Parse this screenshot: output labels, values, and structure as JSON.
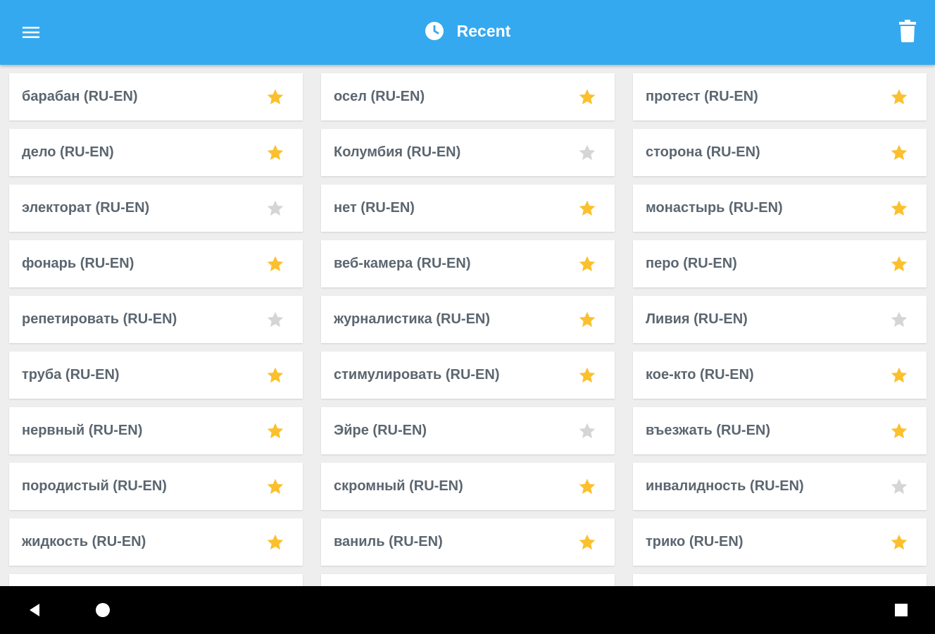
{
  "appbar": {
    "title": "Recent",
    "menu_icon": "hamburger-icon",
    "title_icon": "clock-icon",
    "trash_icon": "trash-icon",
    "background_color": "#35a9ef"
  },
  "colors": {
    "star_on": "#fbc02d",
    "star_off": "#d5d5d5",
    "label": "#5b6670"
  },
  "items": [
    {
      "label": "барабан (RU-EN)",
      "starred": true
    },
    {
      "label": "осел (RU-EN)",
      "starred": true
    },
    {
      "label": "протест (RU-EN)",
      "starred": true
    },
    {
      "label": "дело (RU-EN)",
      "starred": true
    },
    {
      "label": "Колумбия (RU-EN)",
      "starred": false
    },
    {
      "label": "сторона (RU-EN)",
      "starred": true
    },
    {
      "label": "электорат (RU-EN)",
      "starred": false
    },
    {
      "label": "нет (RU-EN)",
      "starred": true
    },
    {
      "label": "монастырь (RU-EN)",
      "starred": true
    },
    {
      "label": "фонарь (RU-EN)",
      "starred": true
    },
    {
      "label": "веб-камера (RU-EN)",
      "starred": true
    },
    {
      "label": "перо (RU-EN)",
      "starred": true
    },
    {
      "label": "репетировать (RU-EN)",
      "starred": false
    },
    {
      "label": "журналистика (RU-EN)",
      "starred": true
    },
    {
      "label": "Ливия (RU-EN)",
      "starred": false
    },
    {
      "label": "труба (RU-EN)",
      "starred": true
    },
    {
      "label": "стимулировать (RU-EN)",
      "starred": true
    },
    {
      "label": "кое-кто (RU-EN)",
      "starred": true
    },
    {
      "label": "нервный (RU-EN)",
      "starred": true
    },
    {
      "label": "Эйре (RU-EN)",
      "starred": false
    },
    {
      "label": "въезжать (RU-EN)",
      "starred": true
    },
    {
      "label": "породистый (RU-EN)",
      "starred": true
    },
    {
      "label": "скромный (RU-EN)",
      "starred": true
    },
    {
      "label": "инвалидность (RU-EN)",
      "starred": false
    },
    {
      "label": "жидкость (RU-EN)",
      "starred": true
    },
    {
      "label": "ваниль (RU-EN)",
      "starred": true
    },
    {
      "label": "трико (RU-EN)",
      "starred": true
    },
    {
      "label": "",
      "starred": false
    },
    {
      "label": "",
      "starred": false
    },
    {
      "label": "",
      "starred": false
    }
  ],
  "navbar": {
    "back_icon": "back-triangle-icon",
    "home_icon": "home-circle-icon",
    "recents_icon": "recents-square-icon"
  }
}
